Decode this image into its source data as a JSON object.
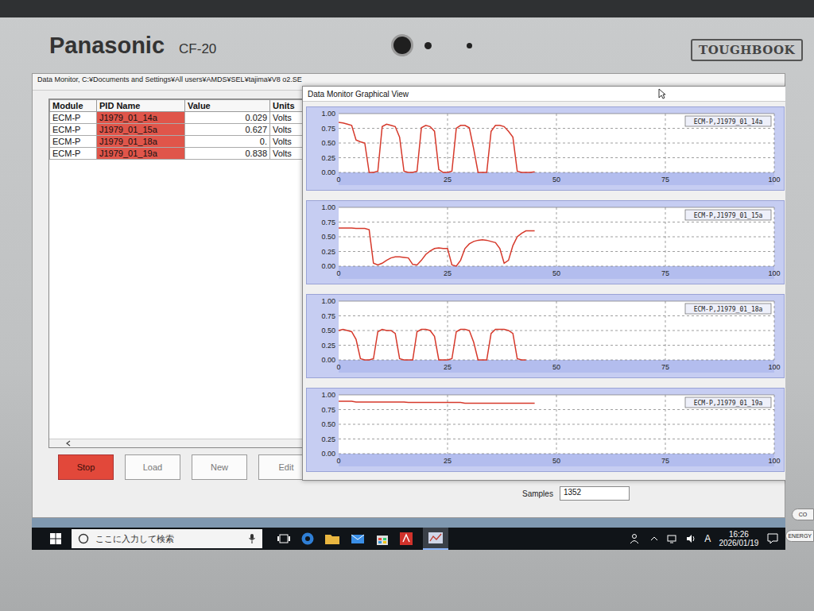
{
  "device": {
    "brand": "Panasonic",
    "model": "CF-20",
    "badge": "TOUGHBOOK",
    "stickers": [
      "CO",
      "ENERGY"
    ]
  },
  "window": {
    "title": "Data Monitor, C:¥Documents and Settings¥All users¥AMDS¥SEL¥tajima¥V8 o2.SE"
  },
  "table": {
    "columns": [
      "Module",
      "PID Name",
      "Value",
      "Units"
    ],
    "rows": [
      {
        "module": "ECM-P",
        "pid": "J1979_01_14a",
        "value": "0.029",
        "units": "Volts"
      },
      {
        "module": "ECM-P",
        "pid": "J1979_01_15a",
        "value": "0.627",
        "units": "Volts"
      },
      {
        "module": "ECM-P",
        "pid": "J1979_01_18a",
        "value": "0.",
        "units": "Volts"
      },
      {
        "module": "ECM-P",
        "pid": "J1979_01_19a",
        "value": "0.838",
        "units": "Volts"
      }
    ]
  },
  "buttons": [
    {
      "label": "Stop",
      "active": true
    },
    {
      "label": "Load",
      "active": false
    },
    {
      "label": "New",
      "active": false
    },
    {
      "label": "Edit",
      "active": false
    }
  ],
  "samples": {
    "label": "Samples",
    "value": "1352"
  },
  "graph_window": {
    "title": "Data Monitor Graphical View",
    "y_ticks": [
      "1.00",
      "0.75",
      "0.50",
      "0.25",
      "0.00"
    ],
    "x_ticks": [
      "0",
      "25",
      "50",
      "75",
      "100"
    ],
    "charts": [
      {
        "legend": "ECM-P,J1979_01_14a",
        "values": [
          0.85,
          0.84,
          0.82,
          0.8,
          0.55,
          0.52,
          0.5,
          0.0,
          0.0,
          0.02,
          0.78,
          0.82,
          0.8,
          0.78,
          0.6,
          0.02,
          0.0,
          0.0,
          0.02,
          0.76,
          0.8,
          0.78,
          0.7,
          0.05,
          0.0,
          0.0,
          0.02,
          0.75,
          0.8,
          0.8,
          0.76,
          0.4,
          0.0,
          0.0,
          0.0,
          0.7,
          0.8,
          0.8,
          0.78,
          0.7,
          0.6,
          0.02,
          0.0,
          0.0,
          0.0,
          0.01
        ]
      },
      {
        "legend": "ECM-P,J1979_01_15a",
        "values": [
          0.65,
          0.65,
          0.65,
          0.65,
          0.64,
          0.64,
          0.64,
          0.62,
          0.05,
          0.02,
          0.05,
          0.1,
          0.14,
          0.16,
          0.16,
          0.15,
          0.14,
          0.03,
          0.02,
          0.1,
          0.2,
          0.26,
          0.3,
          0.31,
          0.3,
          0.3,
          0.02,
          0.0,
          0.1,
          0.3,
          0.38,
          0.42,
          0.44,
          0.45,
          0.44,
          0.42,
          0.4,
          0.3,
          0.05,
          0.1,
          0.35,
          0.5,
          0.56,
          0.6,
          0.6,
          0.6
        ]
      },
      {
        "legend": "ECM-P,J1979_01_18a",
        "values": [
          0.5,
          0.52,
          0.5,
          0.48,
          0.35,
          0.02,
          0.0,
          0.0,
          0.02,
          0.48,
          0.52,
          0.5,
          0.5,
          0.45,
          0.02,
          0.0,
          0.0,
          0.0,
          0.48,
          0.52,
          0.52,
          0.5,
          0.4,
          0.0,
          0.0,
          0.0,
          0.02,
          0.48,
          0.52,
          0.52,
          0.5,
          0.3,
          0.0,
          0.0,
          0.0,
          0.45,
          0.52,
          0.52,
          0.52,
          0.5,
          0.45,
          0.02,
          0.0,
          0.0
        ]
      },
      {
        "legend": "ECM-P,J1979_01_19a",
        "values": [
          0.89,
          0.89,
          0.89,
          0.89,
          0.88,
          0.88,
          0.88,
          0.88,
          0.88,
          0.88,
          0.88,
          0.88,
          0.88,
          0.88,
          0.88,
          0.88,
          0.87,
          0.87,
          0.87,
          0.87,
          0.87,
          0.87,
          0.87,
          0.87,
          0.87,
          0.87,
          0.87,
          0.87,
          0.87,
          0.86,
          0.86,
          0.86,
          0.86,
          0.86,
          0.86,
          0.86,
          0.86,
          0.86,
          0.86,
          0.86,
          0.86,
          0.86,
          0.86,
          0.86,
          0.86,
          0.86
        ]
      }
    ]
  },
  "taskbar": {
    "search_placeholder": "ここに入力して検索",
    "ime": "A",
    "time": "16:26",
    "date": "2026/01/19"
  }
}
